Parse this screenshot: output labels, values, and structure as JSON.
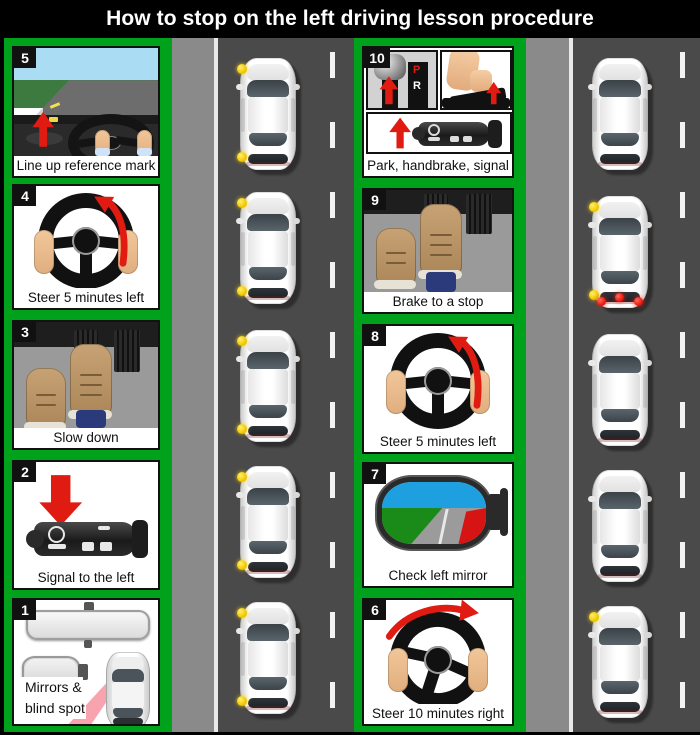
{
  "title": "How to stop on the left driving lesson procedure",
  "colors": {
    "frame_green": "#00a11b",
    "road": "#4a4a4a",
    "pavement": "#8a8a8a",
    "lane_marking": "#f2f2f2",
    "badge_bg": "#111111",
    "indicator_yellow": "#f2c800",
    "brake_red": "#e81a12",
    "title_bg": "#000000",
    "title_text": "#ffffff"
  },
  "left_column": {
    "steps": [
      {
        "number": "5",
        "caption": "Line up reference mark",
        "icon": "road-view-steering-wheel-icon"
      },
      {
        "number": "4",
        "caption": "Steer 5 minutes left",
        "icon": "steering-wheel-left-arrow-icon"
      },
      {
        "number": "3",
        "caption": "Slow down",
        "icon": "feet-on-pedals-icon"
      },
      {
        "number": "2",
        "caption": "Signal to the left",
        "icon": "indicator-stalk-down-arrow-icon"
      },
      {
        "number": "1",
        "caption_line1": "Mirrors &",
        "caption_line2": "blind spot",
        "icon": "mirrors-blind-spot-icon"
      }
    ]
  },
  "right_column": {
    "steps": [
      {
        "number": "10",
        "caption": "Park, handbrake, signal",
        "icon": "gear-handbrake-signal-icon"
      },
      {
        "number": "9",
        "caption": "Brake to a stop",
        "icon": "feet-braking-icon"
      },
      {
        "number": "8",
        "caption": "Steer 5 minutes left",
        "icon": "steering-wheel-left-arrow-icon"
      },
      {
        "number": "7",
        "caption": "Check left mirror",
        "icon": "side-mirror-icon"
      },
      {
        "number": "6",
        "caption": "Steer 10 minutes right",
        "icon": "steering-wheel-right-arrow-icon"
      }
    ]
  },
  "road_left": {
    "cars": [
      {
        "indicators_on": true,
        "brake_lights_on": false
      },
      {
        "indicators_on": true,
        "brake_lights_on": false
      },
      {
        "indicators_on": true,
        "brake_lights_on": false
      },
      {
        "indicators_on": true,
        "brake_lights_on": false
      },
      {
        "indicators_on": true,
        "brake_lights_on": false
      }
    ]
  },
  "road_right": {
    "cars": [
      {
        "indicators_on": false,
        "brake_lights_on": false
      },
      {
        "indicators_on": true,
        "brake_lights_on": true
      },
      {
        "indicators_on": false,
        "brake_lights_on": false
      },
      {
        "indicators_on": false,
        "brake_lights_on": false
      },
      {
        "indicators_on": false,
        "brake_lights_on": false
      }
    ]
  }
}
